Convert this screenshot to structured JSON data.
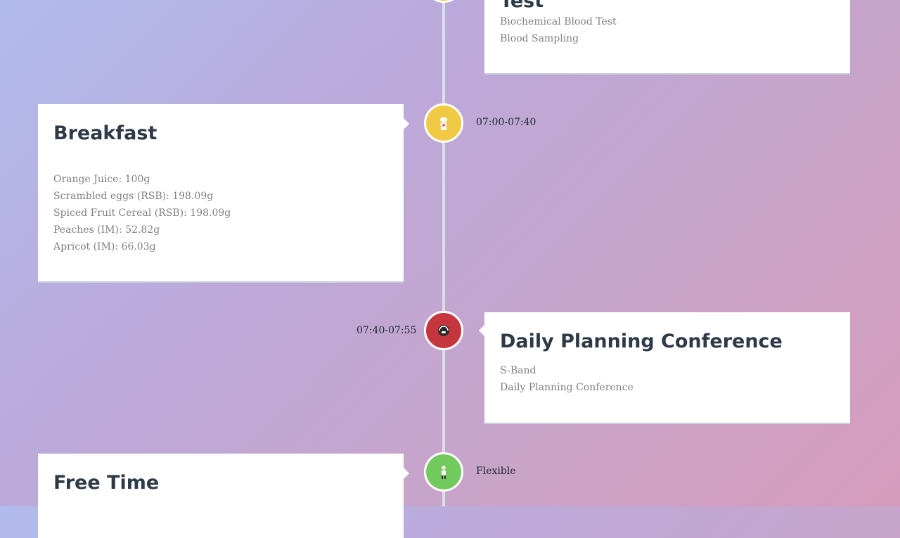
{
  "timeline": {
    "events": [
      {
        "title": "Test",
        "lines": [
          "Biochemical Blood Test",
          "Blood Sampling"
        ],
        "node_color": "#f0c945",
        "icon": "syringe-icon"
      },
      {
        "title": "Breakfast",
        "time": "07:00-07:40",
        "lines": [
          "Orange Juice: 100g",
          "Scrambled eggs (RSB): 198.09g",
          "Spiced Fruit Cereal (RSB): 198.09g",
          "Peaches (IM): 52.82g",
          "Apricot (IM): 66.03g"
        ],
        "node_color": "#f0c945",
        "icon": "chef-icon"
      },
      {
        "title": "Daily Planning Conference",
        "time": "07:40-07:55",
        "lines": [
          "S-Band",
          "Daily Planning Conference"
        ],
        "node_color": "#c6363e",
        "icon": "headset-icon"
      },
      {
        "title": "Free Time",
        "time": "Flexible",
        "lines": [],
        "node_color": "#72c95e",
        "icon": "person-icon"
      }
    ]
  }
}
